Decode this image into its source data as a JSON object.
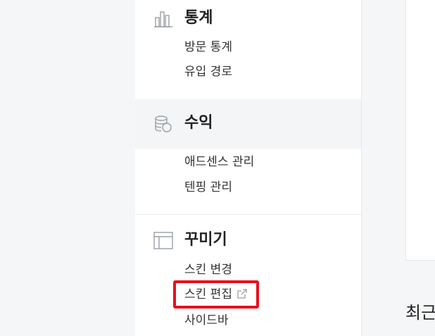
{
  "sidebar": {
    "sections": [
      {
        "title": "통계",
        "icon": "bar-chart-icon",
        "items": [
          "방문 통계",
          "유입 경로"
        ]
      },
      {
        "title": "수익",
        "icon": "coins-icon",
        "items": [
          "애드센스 관리",
          "텐핑 관리"
        ]
      },
      {
        "title": "꾸미기",
        "icon": "layout-icon",
        "items": [
          "스킨 변경",
          "스킨 편집",
          "사이드바"
        ]
      }
    ]
  },
  "right_panel": {
    "heading_partial": "최근"
  },
  "colors": {
    "highlight": "#e8101d",
    "active_section_bg": "#f4f5f6"
  }
}
